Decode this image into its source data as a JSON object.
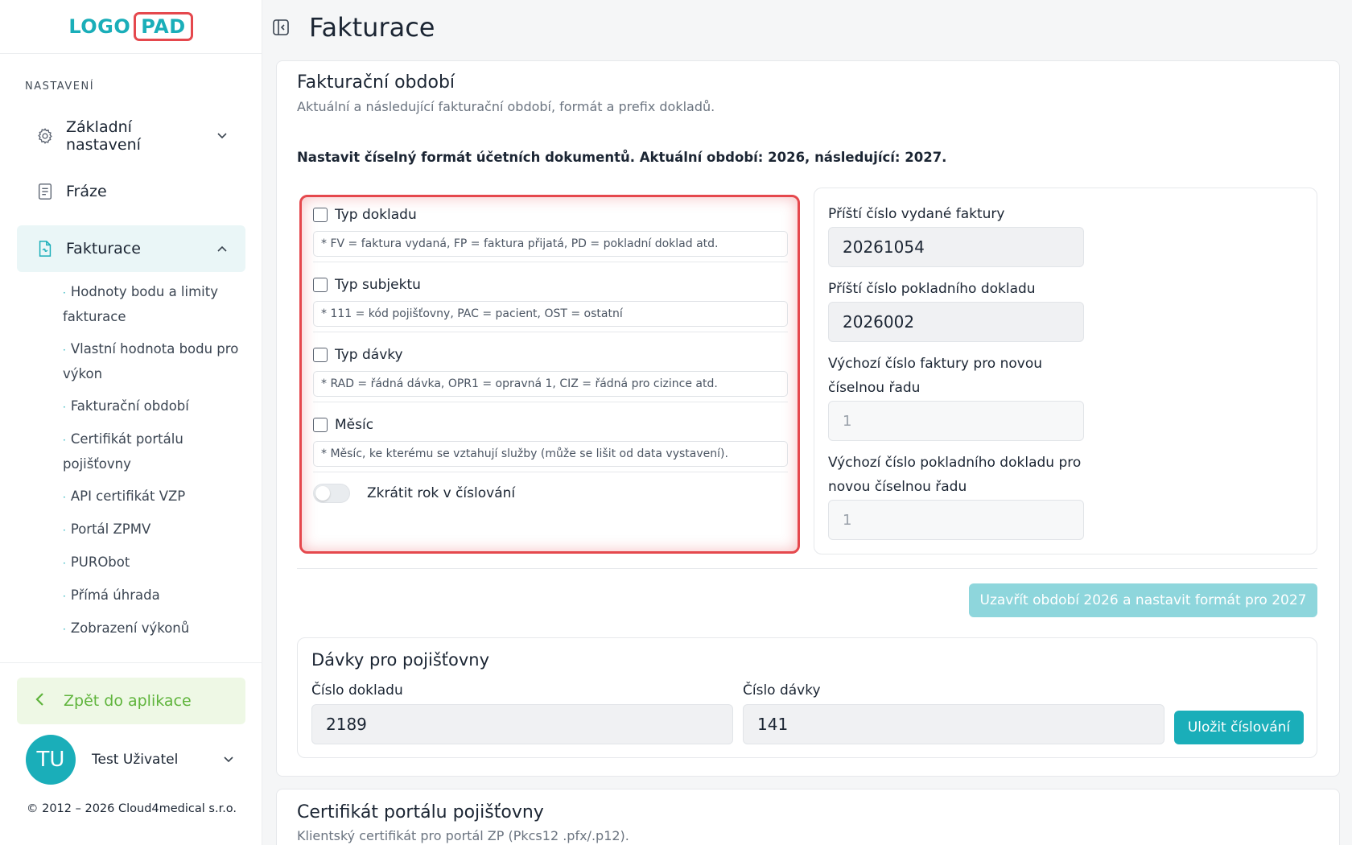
{
  "logo": {
    "part1": "LOGO",
    "part2": "PAD"
  },
  "sidebar": {
    "section_title": "NASTAVENÍ",
    "items": [
      {
        "label": "Základní nastavení",
        "icon": "gear-icon"
      },
      {
        "label": "Fráze",
        "icon": "document-icon"
      },
      {
        "label": "Fakturace",
        "icon": "invoice-icon"
      }
    ],
    "sub_items": [
      {
        "label": "Hodnoty bodu a limity fakturace"
      },
      {
        "label": "Vlastní hodnota bodu pro výkon"
      },
      {
        "label": "Fakturační období"
      },
      {
        "label": "Certifikát portálu pojišťovny"
      },
      {
        "label": "API certifikát VZP"
      },
      {
        "label": "Portál ZPMV"
      },
      {
        "label": "PURObot"
      },
      {
        "label": "Přímá úhrada"
      },
      {
        "label": "Zobrazení výkonů"
      }
    ],
    "back_label": "Zpět do aplikace",
    "user": {
      "initials": "TU",
      "name": "Test Uživatel"
    },
    "copyright": "© 2012 – 2026 Cloud4medical s.r.o."
  },
  "header": {
    "title": "Fakturace"
  },
  "billing_period": {
    "title": "Fakturační období",
    "subtitle": "Aktuální a následující fakturační období, formát a prefix dokladů.",
    "info": "Nastavit číselný formát účetních dokumentů. Aktuální období: 2026, následující: 2027.",
    "format_options": [
      {
        "label": "Typ dokladu",
        "hint": "* FV = faktura vydaná, FP = faktura přijatá, PD = pokladní doklad atd."
      },
      {
        "label": "Typ subjektu",
        "hint": "* 111 = kód pojišťovny, PAC = pacient, OST = ostatní"
      },
      {
        "label": "Typ dávky",
        "hint": "* RAD = řádná dávka, OPR1 = opravná 1, CIZ = řádná pro cizince atd."
      },
      {
        "label": "Měsíc",
        "hint": "* Měsíc, ke kterému se vztahují služby (může se lišit od data vystavení)."
      }
    ],
    "toggle_label": "Zkrátit rok v číslování",
    "next_invoice_label": "Příští číslo vydané faktury",
    "next_invoice_value": "20261054",
    "next_cash_label": "Příští číslo pokladního dokladu",
    "next_cash_value": "2026002",
    "default_invoice_label": "Výchozí číslo faktury pro novou číselnou řadu",
    "default_invoice_value": "1",
    "default_cash_label": "Výchozí číslo pokladního dokladu pro novou číselnou řadu",
    "default_cash_value": "1",
    "close_button": "Uzavřít období 2026 a nastavit formát pro 2027"
  },
  "batches": {
    "title": "Dávky pro pojišťovny",
    "doc_label": "Číslo dokladu",
    "doc_value": "2189",
    "batch_label": "Číslo dávky",
    "batch_value": "141",
    "save_button": "Uložit číslování"
  },
  "certificate": {
    "title": "Certifikát portálu pojišťovny",
    "subtitle": "Klientský certifikát pro portál ZP (Pkcs12 .pfx/.p12)."
  },
  "colors": {
    "accent": "#1aaeb9",
    "highlight": "#e5484d",
    "back": "#5fb43c"
  }
}
